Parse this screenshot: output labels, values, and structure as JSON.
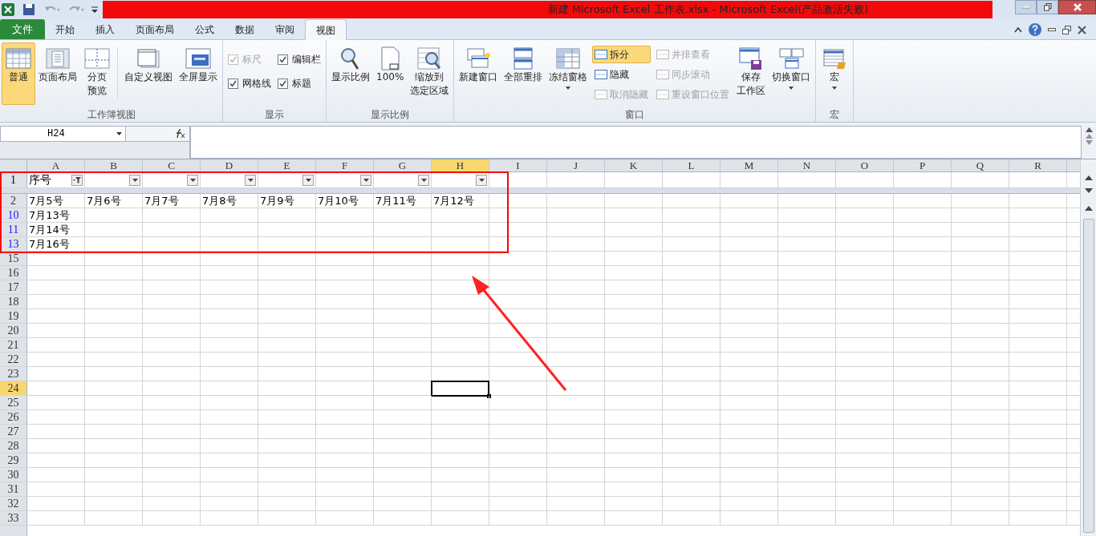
{
  "window": {
    "title": "新建 Microsoft Excel 工作表.xlsx  -  Microsoft Excel(产品激活失败)"
  },
  "tabs": [
    {
      "label": "文件",
      "kind": "file",
      "selected": false
    },
    {
      "label": "开始",
      "kind": "tab",
      "selected": false
    },
    {
      "label": "插入",
      "kind": "tab",
      "selected": false
    },
    {
      "label": "页面布局",
      "kind": "tab",
      "selected": false
    },
    {
      "label": "公式",
      "kind": "tab",
      "selected": false
    },
    {
      "label": "数据",
      "kind": "tab",
      "selected": false
    },
    {
      "label": "审阅",
      "kind": "tab",
      "selected": false
    },
    {
      "label": "视图",
      "kind": "tab",
      "selected": true
    }
  ],
  "ribbon_groups": [
    {
      "label": "工作簿视图",
      "items": [
        {
          "kind": "large",
          "lines": [
            "普通"
          ],
          "selected": true,
          "dropdown": false
        },
        {
          "kind": "large",
          "lines": [
            "页面布局"
          ],
          "selected": false,
          "dropdown": false
        },
        {
          "kind": "large",
          "lines": [
            "分页",
            "预览"
          ],
          "selected": false,
          "dropdown": false
        },
        {
          "kind": "separator"
        },
        {
          "kind": "large",
          "lines": [
            "自定义视图"
          ],
          "selected": false,
          "dropdown": false
        },
        {
          "kind": "large",
          "lines": [
            "全屏显示"
          ],
          "selected": false,
          "dropdown": false
        }
      ]
    },
    {
      "label": "显示",
      "items": [
        {
          "kind": "checks",
          "checks": [
            {
              "label": "标尺",
              "checked": true,
              "disabled": true
            },
            {
              "label": "网格线",
              "checked": true,
              "disabled": false
            }
          ]
        },
        {
          "kind": "checks",
          "checks": [
            {
              "label": "编辑栏",
              "checked": true,
              "disabled": false
            },
            {
              "label": "标题",
              "checked": true,
              "disabled": false
            }
          ]
        }
      ]
    },
    {
      "label": "显示比例",
      "items": [
        {
          "kind": "large",
          "lines": [
            "显示比例"
          ],
          "selected": false,
          "dropdown": false
        },
        {
          "kind": "large",
          "lines": [
            "100%"
          ],
          "selected": false,
          "dropdown": false
        },
        {
          "kind": "large",
          "lines": [
            "缩放到",
            "选定区域"
          ],
          "selected": false,
          "dropdown": false
        }
      ]
    },
    {
      "label": "窗口",
      "items": [
        {
          "kind": "large",
          "lines": [
            "新建窗口"
          ],
          "selected": false,
          "dropdown": false
        },
        {
          "kind": "large",
          "lines": [
            "全部重排"
          ],
          "selected": false,
          "dropdown": false
        },
        {
          "kind": "large",
          "lines": [
            "冻结窗格"
          ],
          "selected": false,
          "dropdown": true
        },
        {
          "kind": "smalls",
          "buttons": [
            {
              "label": "拆分",
              "selected": true,
              "disabled": false
            },
            {
              "label": "隐藏",
              "selected": false,
              "disabled": false
            },
            {
              "label": "取消隐藏",
              "selected": false,
              "disabled": true
            }
          ]
        },
        {
          "kind": "smalls",
          "buttons": [
            {
              "label": "并排查看",
              "selected": false,
              "disabled": true
            },
            {
              "label": "同步滚动",
              "selected": false,
              "disabled": true
            },
            {
              "label": "重设窗口位置",
              "selected": false,
              "disabled": true
            }
          ]
        },
        {
          "kind": "large",
          "lines": [
            "保存",
            "工作区"
          ],
          "selected": false,
          "dropdown": false
        },
        {
          "kind": "large",
          "lines": [
            "切换窗口"
          ],
          "selected": false,
          "dropdown": true
        }
      ]
    },
    {
      "label": "宏",
      "items": [
        {
          "kind": "large",
          "lines": [
            "宏"
          ],
          "selected": false,
          "dropdown": true
        }
      ]
    }
  ],
  "name_box": "H24",
  "columns": [
    {
      "label": "A",
      "selected": false
    },
    {
      "label": "B",
      "selected": false
    },
    {
      "label": "C",
      "selected": false
    },
    {
      "label": "D",
      "selected": false
    },
    {
      "label": "E",
      "selected": false
    },
    {
      "label": "F",
      "selected": false
    },
    {
      "label": "G",
      "selected": false
    },
    {
      "label": "H",
      "selected": true
    },
    {
      "label": "I",
      "selected": false
    },
    {
      "label": "J",
      "selected": false
    },
    {
      "label": "K",
      "selected": false
    },
    {
      "label": "L",
      "selected": false
    },
    {
      "label": "M",
      "selected": false
    },
    {
      "label": "N",
      "selected": false
    },
    {
      "label": "O",
      "selected": false
    },
    {
      "label": "P",
      "selected": false
    },
    {
      "label": "Q",
      "selected": false
    },
    {
      "label": "R",
      "selected": false
    }
  ],
  "header_row": {
    "number": "1",
    "label": "序号",
    "filters": [
      {
        "applied": true
      },
      {
        "applied": false
      },
      {
        "applied": false
      },
      {
        "applied": false
      },
      {
        "applied": false
      },
      {
        "applied": false
      },
      {
        "applied": false
      },
      {
        "applied": false
      }
    ]
  },
  "rows": [
    {
      "number": "2",
      "filtered": false,
      "selected": false,
      "cells": [
        "7月5号",
        "7月6号",
        "7月7号",
        "7月8号",
        "7月9号",
        "7月10号",
        "7月11号",
        "7月12号"
      ]
    },
    {
      "number": "10",
      "filtered": true,
      "selected": false,
      "cells": [
        "7月13号"
      ]
    },
    {
      "number": "11",
      "filtered": true,
      "selected": false,
      "cells": [
        "7月14号"
      ]
    },
    {
      "number": "13",
      "filtered": true,
      "selected": false,
      "cells": [
        "7月16号"
      ]
    },
    {
      "number": "15",
      "filtered": false,
      "selected": false
    },
    {
      "number": "16",
      "filtered": false,
      "selected": false
    },
    {
      "number": "17",
      "filtered": false,
      "selected": false
    },
    {
      "number": "18",
      "filtered": false,
      "selected": false
    },
    {
      "number": "19",
      "filtered": false,
      "selected": false
    },
    {
      "number": "20",
      "filtered": false,
      "selected": false
    },
    {
      "number": "21",
      "filtered": false,
      "selected": false
    },
    {
      "number": "22",
      "filtered": false,
      "selected": false
    },
    {
      "number": "23",
      "filtered": false,
      "selected": false
    },
    {
      "number": "24",
      "filtered": false,
      "selected": true
    },
    {
      "number": "25",
      "filtered": false,
      "selected": false
    },
    {
      "number": "26",
      "filtered": false,
      "selected": false
    },
    {
      "number": "27",
      "filtered": false,
      "selected": false
    },
    {
      "number": "28",
      "filtered": false,
      "selected": false
    },
    {
      "number": "29",
      "filtered": false,
      "selected": false
    },
    {
      "number": "30",
      "filtered": false,
      "selected": false
    },
    {
      "number": "31",
      "filtered": false,
      "selected": false
    },
    {
      "number": "32",
      "filtered": false,
      "selected": false
    },
    {
      "number": "33",
      "filtered": false,
      "selected": false
    }
  ]
}
